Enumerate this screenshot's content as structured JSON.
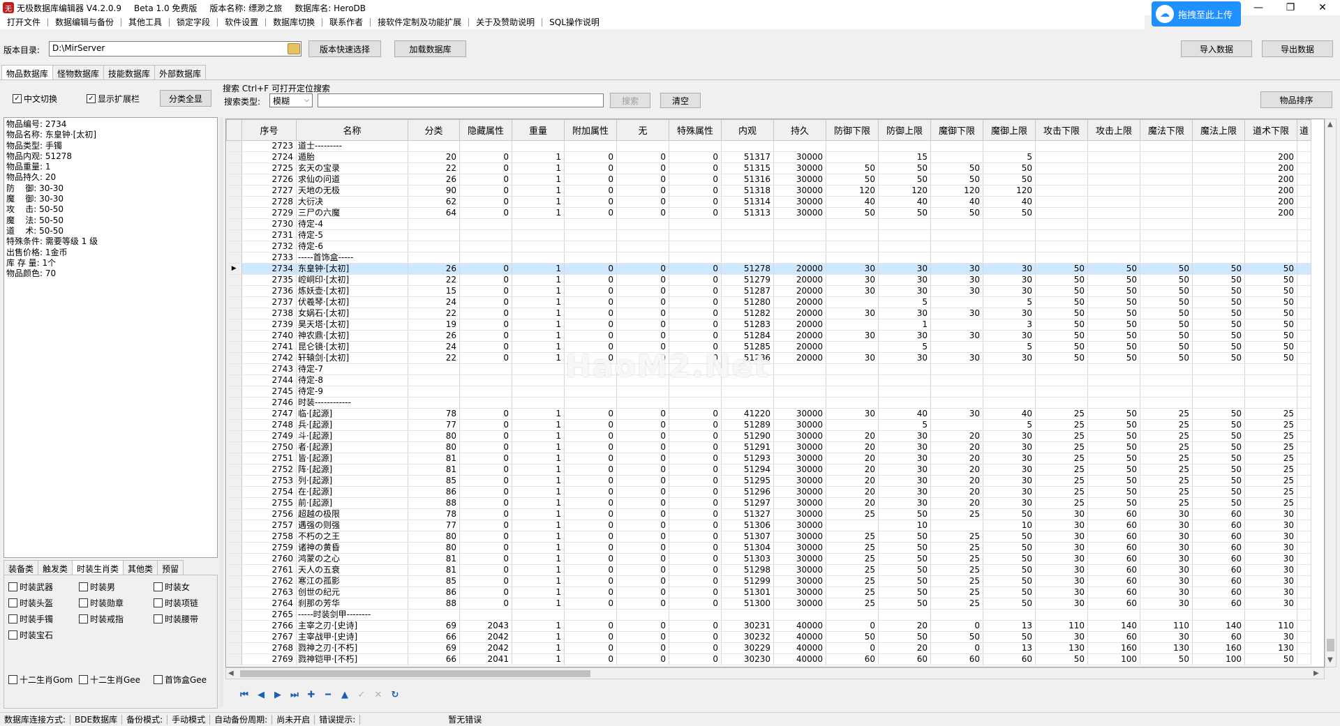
{
  "titlebar": {
    "app_name": "无极数据库编辑器 V4.2.0.9",
    "beta": "Beta 1.0 免费版",
    "version_name": "版本名称: 缥渺之旅",
    "db_name": "数据库名: HeroDB",
    "upload_label": "拖拽至此上传",
    "minimize": "—",
    "restore": "❐",
    "close": "✕"
  },
  "menu": [
    "打开文件",
    "数据编辑与备份",
    "其他工具",
    "锁定字段",
    "软件设置",
    "数据库切换",
    "联系作者",
    "接软件定制及功能扩展",
    "关于及赞助说明",
    "SQL操作说明"
  ],
  "toolbar": {
    "dir_label": "版本目录:",
    "dir_value": "D:\\MirServer",
    "quick_select": "版本快速选择",
    "load_db": "加载数据库",
    "import": "导入数据",
    "export": "导出数据"
  },
  "tabs": [
    "物品数据库",
    "怪物数据库",
    "技能数据库",
    "外部数据库"
  ],
  "options": {
    "chinese_switch": "中文切换",
    "show_ext": "显示扩展栏",
    "show_all": "分类全显",
    "search_title": "搜索   Ctrl+F 可打开定位搜索",
    "search_type_label": "搜索类型:",
    "search_type_value": "模糊",
    "search_value": "",
    "search_btn": "搜索",
    "clear_btn": "清空",
    "sort_btn": "物品排序"
  },
  "info": [
    "物品编号: 2734",
    "物品名称: 东皇钟·[太初]",
    "物品类型: 手镯",
    "物品内观: 51278",
    "物品重量: 1",
    "物品持久: 20",
    "防    御: 30-30",
    "魔    御: 30-30",
    "攻    击: 50-50",
    "魔    法: 50-50",
    "道    术: 50-50",
    "特殊条件: 需要等级 1 级",
    "出售价格: 1金币",
    "库 存 量: 1个",
    "物品颜色: 70"
  ],
  "lower_tabs": [
    "装备类",
    "触发类",
    "时装生肖类",
    "其他类",
    "预留"
  ],
  "lower_checks": [
    "时装武器",
    "时装男",
    "时装女",
    "时装头盔",
    "时装勋章",
    "时装项链",
    "时装手镯",
    "时装戒指",
    "时装腰带",
    "时装宝石"
  ],
  "lower_checks2": [
    "十二生肖Gom",
    "十二生肖Gee",
    "首饰盒Gee"
  ],
  "grid": {
    "columns": [
      "序号",
      "名称",
      "分类",
      "隐藏属性",
      "重量",
      "附加属性",
      "无",
      "特殊属性",
      "内观",
      "持久",
      "防御下限",
      "防御上限",
      "魔御下限",
      "魔御上限",
      "攻击下限",
      "攻击上限",
      "魔法下限",
      "魔法上限",
      "道术下限",
      "道"
    ],
    "selected_id": "2734",
    "rows": [
      [
        "2723",
        "道士---------",
        "",
        "",
        "",
        "",
        "",
        "",
        "",
        "",
        "",
        "",
        "",
        "",
        "",
        "",
        "",
        "",
        "",
        ""
      ],
      [
        "2724",
        "遁胎",
        "20",
        "0",
        "1",
        "0",
        "0",
        "0",
        "51317",
        "30000",
        "",
        "15",
        "",
        "5",
        "",
        "",
        "",
        "",
        "200",
        ""
      ],
      [
        "2725",
        "玄天の宝录",
        "22",
        "0",
        "1",
        "0",
        "0",
        "0",
        "51315",
        "30000",
        "50",
        "50",
        "50",
        "50",
        "",
        "",
        "",
        "",
        "200",
        ""
      ],
      [
        "2726",
        "求仙の问道",
        "26",
        "0",
        "1",
        "0",
        "0",
        "0",
        "51316",
        "30000",
        "50",
        "50",
        "50",
        "50",
        "",
        "",
        "",
        "",
        "200",
        ""
      ],
      [
        "2727",
        "天地の无极",
        "90",
        "0",
        "1",
        "0",
        "0",
        "0",
        "51318",
        "30000",
        "120",
        "120",
        "120",
        "120",
        "",
        "",
        "",
        "",
        "200",
        ""
      ],
      [
        "2728",
        "大衍决",
        "62",
        "0",
        "1",
        "0",
        "0",
        "0",
        "51314",
        "30000",
        "40",
        "40",
        "40",
        "40",
        "",
        "",
        "",
        "",
        "200",
        ""
      ],
      [
        "2729",
        "三尸の六魔",
        "64",
        "0",
        "1",
        "0",
        "0",
        "0",
        "51313",
        "30000",
        "50",
        "50",
        "50",
        "50",
        "",
        "",
        "",
        "",
        "200",
        ""
      ],
      [
        "2730",
        "待定-4",
        "",
        "",
        "",
        "",
        "",
        "",
        "",
        "",
        "",
        "",
        "",
        "",
        "",
        "",
        "",
        "",
        "",
        ""
      ],
      [
        "2731",
        "待定-5",
        "",
        "",
        "",
        "",
        "",
        "",
        "",
        "",
        "",
        "",
        "",
        "",
        "",
        "",
        "",
        "",
        "",
        ""
      ],
      [
        "2732",
        "待定-6",
        "",
        "",
        "",
        "",
        "",
        "",
        "",
        "",
        "",
        "",
        "",
        "",
        "",
        "",
        "",
        "",
        "",
        ""
      ],
      [
        "2733",
        "-----首饰盒-----",
        "",
        "",
        "",
        "",
        "",
        "",
        "",
        "",
        "",
        "",
        "",
        "",
        "",
        "",
        "",
        "",
        "",
        ""
      ],
      [
        "2734",
        "东皇钟·[太初]",
        "26",
        "0",
        "1",
        "0",
        "0",
        "0",
        "51278",
        "20000",
        "30",
        "30",
        "30",
        "30",
        "50",
        "50",
        "50",
        "50",
        "50",
        ""
      ],
      [
        "2735",
        "崆峒印·[太初]",
        "22",
        "0",
        "1",
        "0",
        "0",
        "0",
        "51279",
        "20000",
        "30",
        "30",
        "30",
        "30",
        "50",
        "50",
        "50",
        "50",
        "50",
        ""
      ],
      [
        "2736",
        "炼妖壶·[太初]",
        "15",
        "0",
        "1",
        "0",
        "0",
        "0",
        "51287",
        "20000",
        "30",
        "30",
        "30",
        "30",
        "50",
        "50",
        "50",
        "50",
        "50",
        ""
      ],
      [
        "2737",
        "伏羲琴·[太初]",
        "24",
        "0",
        "1",
        "0",
        "0",
        "0",
        "51280",
        "20000",
        "",
        "5",
        "",
        "5",
        "50",
        "50",
        "50",
        "50",
        "50",
        ""
      ],
      [
        "2738",
        "女娲石·[太初]",
        "22",
        "0",
        "1",
        "0",
        "0",
        "0",
        "51282",
        "20000",
        "30",
        "30",
        "30",
        "30",
        "50",
        "50",
        "50",
        "50",
        "50",
        ""
      ],
      [
        "2739",
        "昊天塔·[太初]",
        "19",
        "0",
        "1",
        "0",
        "0",
        "0",
        "51283",
        "20000",
        "",
        "1",
        "",
        "3",
        "50",
        "50",
        "50",
        "50",
        "50",
        ""
      ],
      [
        "2740",
        "神农鼎·[太初]",
        "26",
        "0",
        "1",
        "0",
        "0",
        "0",
        "51284",
        "20000",
        "30",
        "30",
        "30",
        "30",
        "50",
        "50",
        "50",
        "50",
        "50",
        ""
      ],
      [
        "2741",
        "昆仑镜·[太初]",
        "24",
        "0",
        "1",
        "0",
        "0",
        "0",
        "51285",
        "20000",
        "",
        "5",
        "",
        "5",
        "50",
        "50",
        "50",
        "50",
        "50",
        ""
      ],
      [
        "2742",
        "轩辕剑·[太初]",
        "22",
        "0",
        "1",
        "0",
        "0",
        "0",
        "51286",
        "20000",
        "30",
        "30",
        "30",
        "30",
        "50",
        "50",
        "50",
        "50",
        "50",
        ""
      ],
      [
        "2743",
        "待定-7",
        "",
        "",
        "",
        "",
        "",
        "",
        "",
        "",
        "",
        "",
        "",
        "",
        "",
        "",
        "",
        "",
        "",
        ""
      ],
      [
        "2744",
        "待定-8",
        "",
        "",
        "",
        "",
        "",
        "",
        "",
        "",
        "",
        "",
        "",
        "",
        "",
        "",
        "",
        "",
        "",
        ""
      ],
      [
        "2745",
        "待定-9",
        "",
        "",
        "",
        "",
        "",
        "",
        "",
        "",
        "",
        "",
        "",
        "",
        "",
        "",
        "",
        "",
        "",
        ""
      ],
      [
        "2746",
        "时装------------",
        "",
        "",
        "",
        "",
        "",
        "",
        "",
        "",
        "",
        "",
        "",
        "",
        "",
        "",
        "",
        "",
        "",
        ""
      ],
      [
        "2747",
        "临·[起源]",
        "78",
        "0",
        "1",
        "0",
        "0",
        "0",
        "41220",
        "30000",
        "30",
        "40",
        "30",
        "40",
        "25",
        "50",
        "25",
        "50",
        "25",
        ""
      ],
      [
        "2748",
        "兵·[起源]",
        "77",
        "0",
        "1",
        "0",
        "0",
        "0",
        "51289",
        "30000",
        "",
        "5",
        "",
        "5",
        "25",
        "50",
        "25",
        "50",
        "25",
        ""
      ],
      [
        "2749",
        "斗·[起源]",
        "80",
        "0",
        "1",
        "0",
        "0",
        "0",
        "51290",
        "30000",
        "20",
        "30",
        "20",
        "30",
        "25",
        "50",
        "25",
        "50",
        "25",
        ""
      ],
      [
        "2750",
        "者·[起源]",
        "80",
        "0",
        "1",
        "0",
        "0",
        "0",
        "51291",
        "30000",
        "20",
        "30",
        "20",
        "30",
        "25",
        "50",
        "25",
        "50",
        "25",
        ""
      ],
      [
        "2751",
        "皆·[起源]",
        "81",
        "0",
        "1",
        "0",
        "0",
        "0",
        "51293",
        "30000",
        "20",
        "30",
        "20",
        "30",
        "25",
        "50",
        "25",
        "50",
        "25",
        ""
      ],
      [
        "2752",
        "阵·[起源]",
        "81",
        "0",
        "1",
        "0",
        "0",
        "0",
        "51294",
        "30000",
        "20",
        "30",
        "20",
        "30",
        "25",
        "50",
        "25",
        "50",
        "25",
        ""
      ],
      [
        "2753",
        "列·[起源]",
        "85",
        "0",
        "1",
        "0",
        "0",
        "0",
        "51295",
        "30000",
        "20",
        "30",
        "20",
        "30",
        "25",
        "50",
        "25",
        "50",
        "25",
        ""
      ],
      [
        "2754",
        "在·[起源]",
        "86",
        "0",
        "1",
        "0",
        "0",
        "0",
        "51296",
        "30000",
        "20",
        "30",
        "20",
        "30",
        "25",
        "50",
        "25",
        "50",
        "25",
        ""
      ],
      [
        "2755",
        "前·[起源]",
        "88",
        "0",
        "1",
        "0",
        "0",
        "0",
        "51297",
        "30000",
        "20",
        "30",
        "20",
        "30",
        "25",
        "50",
        "25",
        "50",
        "25",
        ""
      ],
      [
        "2756",
        "超越の极限",
        "78",
        "0",
        "1",
        "0",
        "0",
        "0",
        "51327",
        "30000",
        "25",
        "50",
        "25",
        "50",
        "30",
        "60",
        "30",
        "60",
        "30",
        ""
      ],
      [
        "2757",
        "遇强の则强",
        "77",
        "0",
        "1",
        "0",
        "0",
        "0",
        "51306",
        "30000",
        "",
        "10",
        "",
        "10",
        "30",
        "60",
        "30",
        "60",
        "30",
        ""
      ],
      [
        "2758",
        "不朽の之王",
        "80",
        "0",
        "1",
        "0",
        "0",
        "0",
        "51307",
        "30000",
        "25",
        "50",
        "25",
        "50",
        "30",
        "60",
        "30",
        "60",
        "30",
        ""
      ],
      [
        "2759",
        "诸神の黄昏",
        "80",
        "0",
        "1",
        "0",
        "0",
        "0",
        "51304",
        "30000",
        "25",
        "50",
        "25",
        "50",
        "30",
        "60",
        "30",
        "60",
        "30",
        ""
      ],
      [
        "2760",
        "鸿蒙の之心",
        "81",
        "0",
        "1",
        "0",
        "0",
        "0",
        "51303",
        "30000",
        "25",
        "50",
        "25",
        "50",
        "30",
        "60",
        "30",
        "60",
        "30",
        ""
      ],
      [
        "2761",
        "天人の五衰",
        "81",
        "0",
        "1",
        "0",
        "0",
        "0",
        "51298",
        "30000",
        "25",
        "50",
        "25",
        "50",
        "30",
        "60",
        "30",
        "60",
        "30",
        ""
      ],
      [
        "2762",
        "寒江の孤影",
        "85",
        "0",
        "1",
        "0",
        "0",
        "0",
        "51299",
        "30000",
        "25",
        "50",
        "25",
        "50",
        "30",
        "60",
        "30",
        "60",
        "30",
        ""
      ],
      [
        "2763",
        "创世の纪元",
        "86",
        "0",
        "1",
        "0",
        "0",
        "0",
        "51301",
        "30000",
        "25",
        "50",
        "25",
        "50",
        "30",
        "60",
        "30",
        "60",
        "30",
        ""
      ],
      [
        "2764",
        "刹那の芳华",
        "88",
        "0",
        "1",
        "0",
        "0",
        "0",
        "51300",
        "30000",
        "25",
        "50",
        "25",
        "50",
        "30",
        "60",
        "30",
        "60",
        "30",
        ""
      ],
      [
        "2765",
        "-----时装剑甲--------",
        "",
        "",
        "",
        "",
        "",
        "",
        "",
        "",
        "",
        "",
        "",
        "",
        "",
        "",
        "",
        "",
        "",
        ""
      ],
      [
        "2766",
        "主宰之刃·[史诗]",
        "69",
        "2043",
        "1",
        "0",
        "0",
        "0",
        "30231",
        "40000",
        "0",
        "20",
        "0",
        "13",
        "110",
        "140",
        "110",
        "140",
        "110",
        ""
      ],
      [
        "2767",
        "主宰战甲·[史诗]",
        "66",
        "2042",
        "1",
        "0",
        "0",
        "0",
        "30232",
        "40000",
        "50",
        "50",
        "50",
        "50",
        "30",
        "60",
        "30",
        "60",
        "30",
        ""
      ],
      [
        "2768",
        "戮神之刃·[不朽]",
        "69",
        "2042",
        "1",
        "0",
        "0",
        "0",
        "30229",
        "40000",
        "0",
        "20",
        "0",
        "13",
        "130",
        "160",
        "130",
        "160",
        "130",
        ""
      ],
      [
        "2769",
        "戮神铠甲·[不朽]",
        "66",
        "2041",
        "1",
        "0",
        "0",
        "0",
        "30230",
        "40000",
        "60",
        "60",
        "60",
        "60",
        "50",
        "100",
        "50",
        "100",
        "50",
        ""
      ]
    ]
  },
  "watermark": "HaoM2.Net",
  "status": [
    "数据库连接方式:",
    "BDE数据库",
    "备份模式:",
    "手动模式",
    "自动备份周期:",
    "尚未开启",
    "错误提示:",
    "暂无错误"
  ]
}
